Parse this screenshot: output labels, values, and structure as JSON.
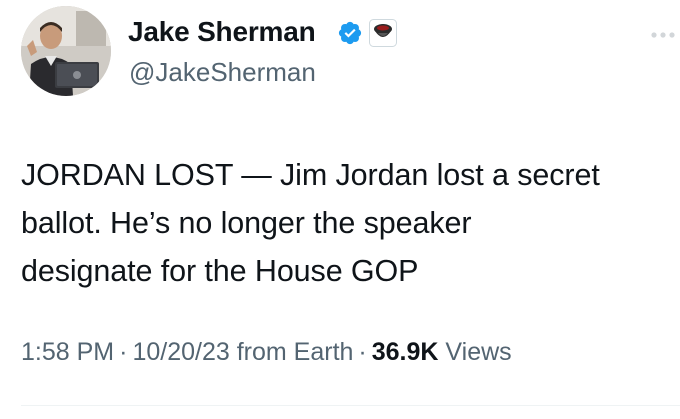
{
  "author": {
    "name": "Jake Sherman",
    "handle": "@JakeSherman"
  },
  "icons": {
    "verified": "verified-badge-icon",
    "affiliate": "affiliate-badge-icon",
    "more": "more-options-icon"
  },
  "colors": {
    "verified_blue": "#1d9bf0",
    "text_primary": "#0f1419",
    "text_secondary": "#536471"
  },
  "tweet": {
    "line1": "JORDAN LOST — Jim Jordan lost a secret",
    "line2": "ballot. He’s no longer the speaker",
    "line3": "designate for the House GOP"
  },
  "meta": {
    "time": "1:58 PM",
    "date": "10/20/23",
    "source": "from Earth",
    "views_count": "36.9K",
    "views_label": "Views",
    "separator": "·"
  }
}
